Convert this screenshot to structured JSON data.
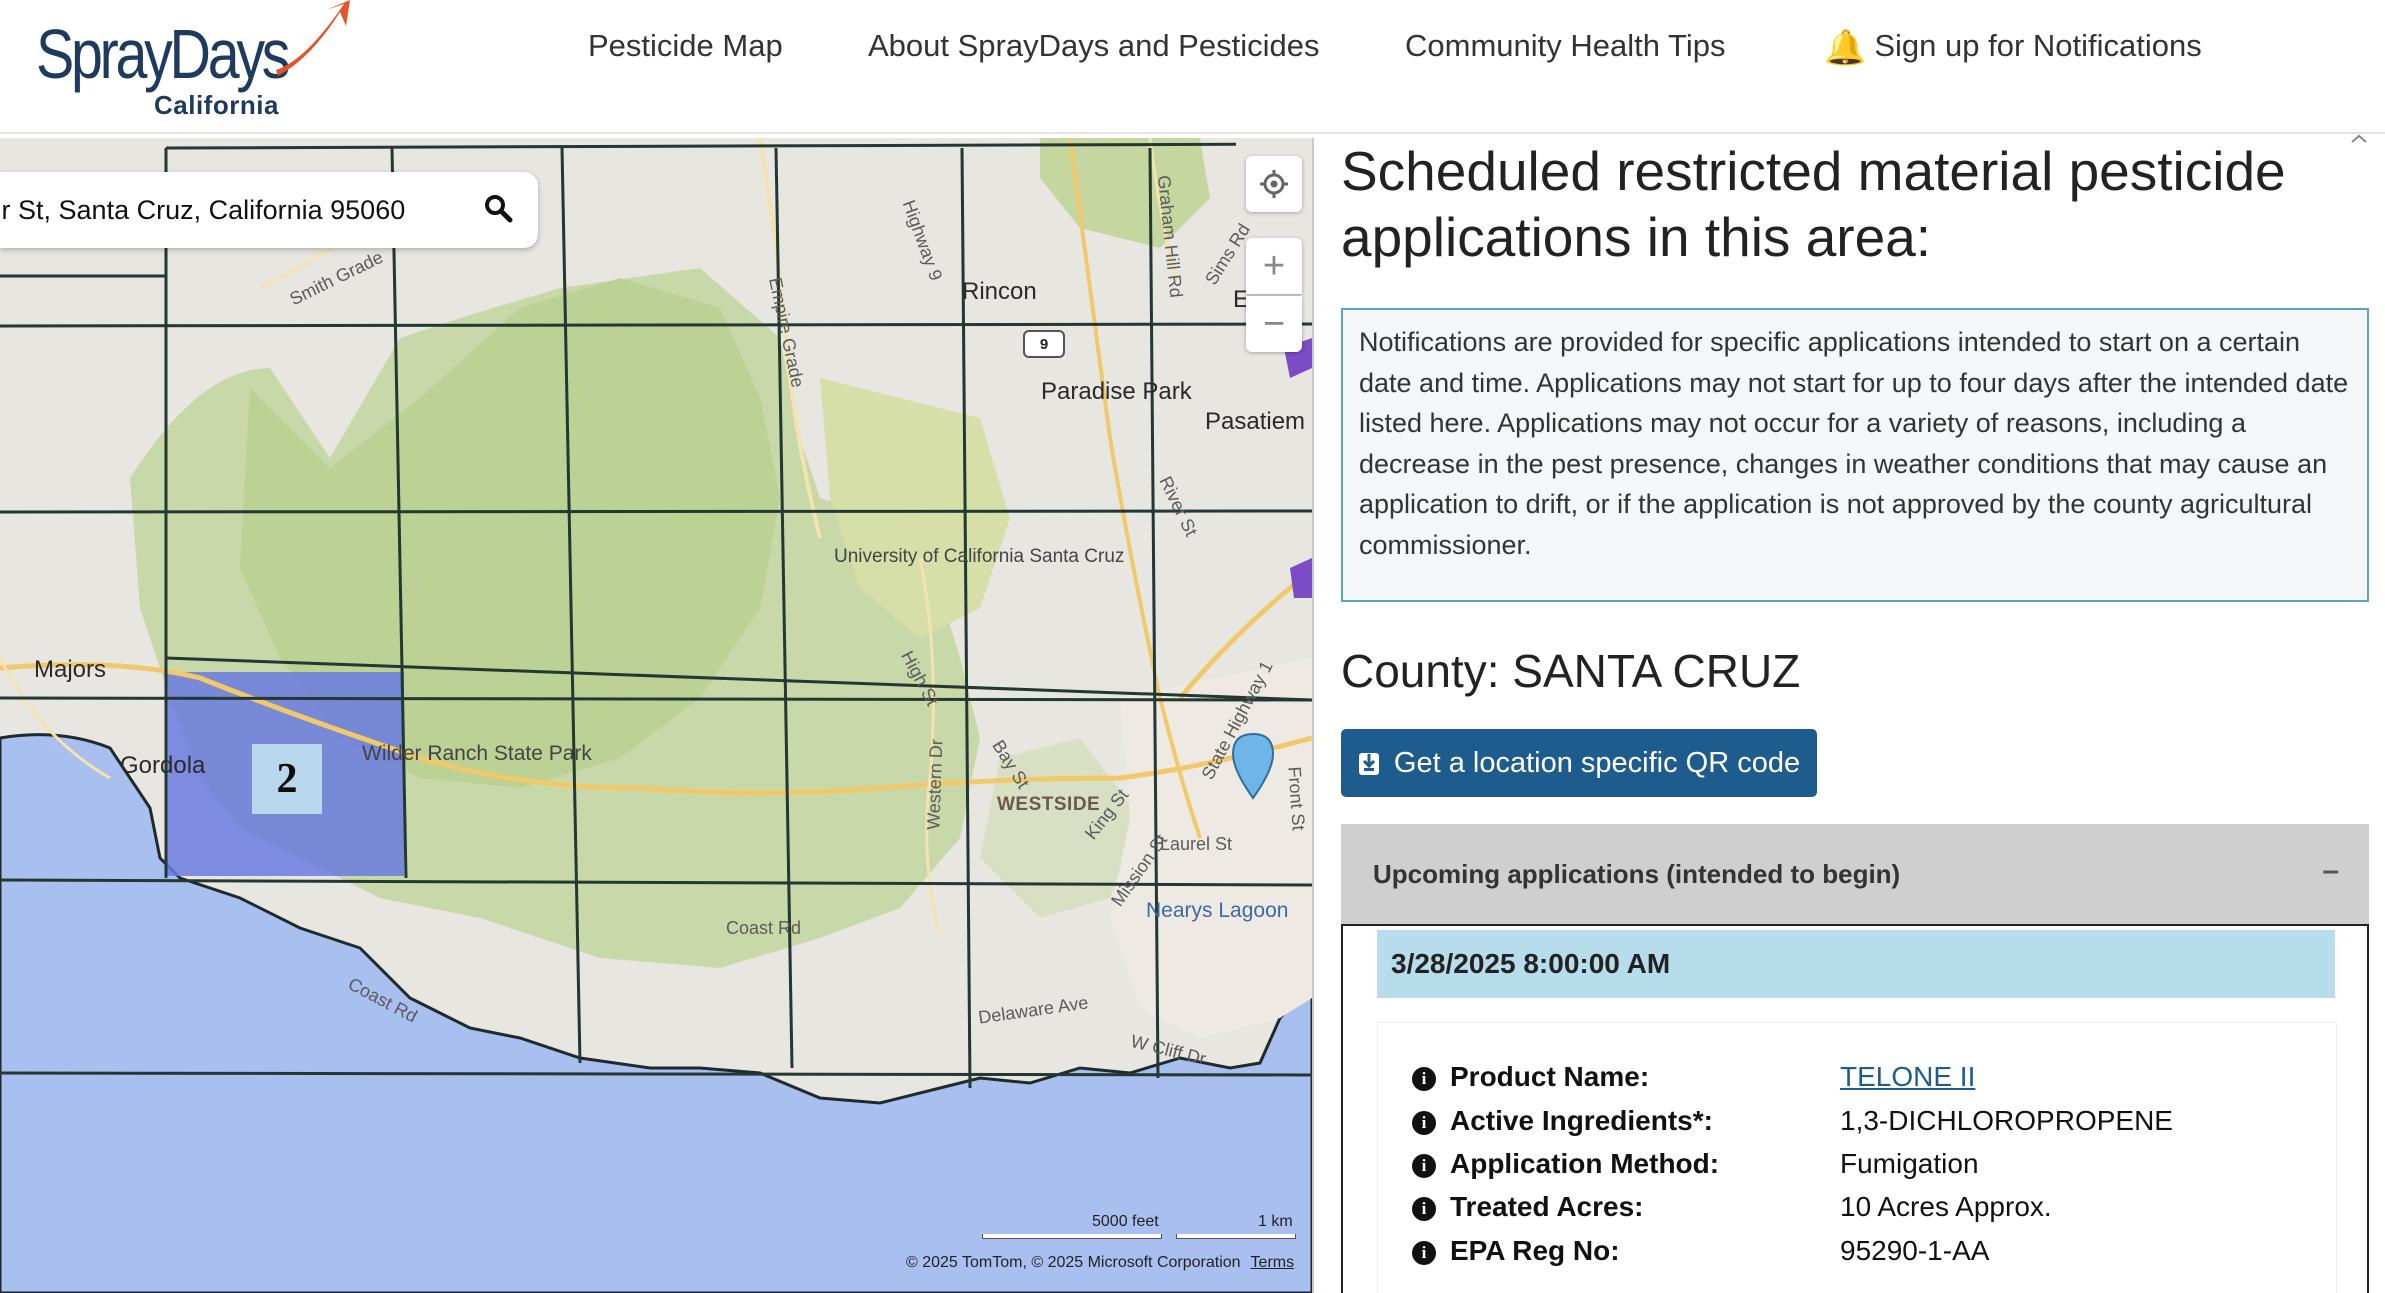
{
  "header": {
    "logo_word": "SprayDays",
    "logo_sub": "California",
    "nav": [
      {
        "label": "Pesticide Map"
      },
      {
        "label": "About SprayDays and Pesticides"
      },
      {
        "label": "Community Health Tips"
      },
      {
        "label": "Sign up for Notifications",
        "icon": "bell-icon"
      }
    ]
  },
  "map": {
    "search_value": "r St, Santa Cruz, California 95060,",
    "grid_badge": "2",
    "route_shield": "9",
    "labels": {
      "rincon": "Rincon",
      "paradise_park": "Paradise Park",
      "pasatiem": "Pasatiem",
      "university": "University of California Santa Cruz",
      "majors": "Majors",
      "gordola": "Gordola",
      "wilder": "Wilder Ranch State Park",
      "westside": "WESTSIDE",
      "nearys": "Nearys Lagoon",
      "coast_rd_1": "Coast Rd",
      "coast_rd_2": "Coast Rd",
      "delaware": "Delaware Ave",
      "cliff": "W Cliff Dr",
      "highway9": "Highway 9",
      "empire": "Empire Grade",
      "graham": "Graham Hill Rd",
      "smith": "Smith Grade",
      "western": "Western Dr",
      "bay": "Bay St",
      "king": "King St",
      "mission": "Mission St",
      "laurel": "Laurel St",
      "front": "Front St",
      "river": "River St",
      "highway1": "State Highway 1",
      "high": "High St",
      "sims": "Sims Rd",
      "e": "E"
    },
    "scale": {
      "feet": "5000 feet",
      "km": "1 km"
    },
    "attribution": "© 2025 TomTom, © 2025 Microsoft Corporation",
    "terms": "Terms"
  },
  "panel": {
    "title": "Scheduled restricted material pesticide applications in this area:",
    "notice": "Notifications are provided for specific applications intended to start on a certain date and time. Applications may not start for up to four days after the intended date listed here. Applications may not occur for a variety of reasons, including a decrease in the pest presence, changes in weather conditions that may cause an application to drift, or if the application is not approved by the county agricultural commissioner.",
    "county": "County: SANTA CRUZ",
    "qr_button": "Get a location specific QR code",
    "accordion_title": "Upcoming applications (intended to begin)",
    "accordion_toggle": "–",
    "application": {
      "date": "3/28/2025 8:00:00 AM",
      "rows": [
        {
          "label": "Product Name:",
          "value": "TELONE II",
          "link": true
        },
        {
          "label": "Active Ingredients*:",
          "value": "1,3-DICHLOROPROPENE"
        },
        {
          "label": "Application Method:",
          "value": "Fumigation"
        },
        {
          "label": "Treated Acres:",
          "value": "10 Acres Approx."
        },
        {
          "label": "EPA Reg No:",
          "value": "95290-1-AA"
        }
      ]
    }
  },
  "colors": {
    "brand_navy": "#1e3a5f",
    "accent_orange": "#e0552b",
    "button_blue": "#1d5c8c",
    "notice_border": "#5aa5b8",
    "date_bar": "#b7dceb",
    "highlight_cell": "#6a7be0"
  }
}
